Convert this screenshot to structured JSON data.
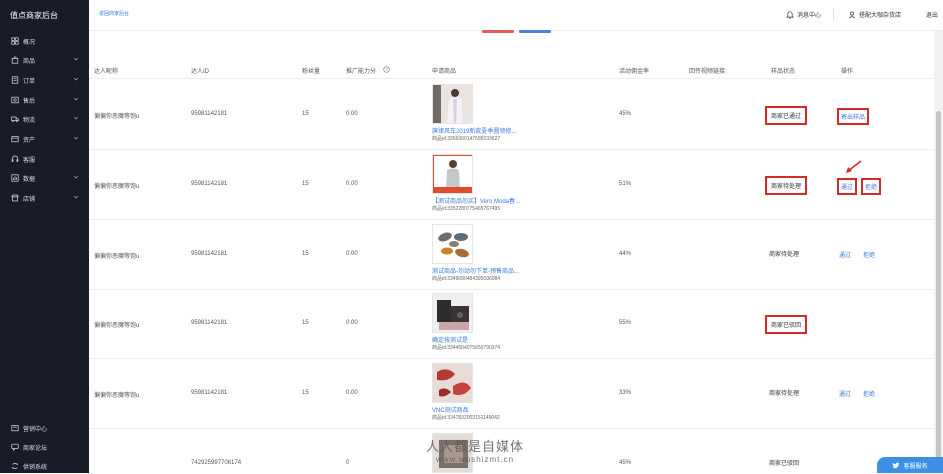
{
  "app": {
    "title": "值点商家后台"
  },
  "sidebar": {
    "items": [
      {
        "label": "概况",
        "icon": "grid-icon",
        "has_chevron": false
      },
      {
        "label": "商品",
        "icon": "bag-icon",
        "has_chevron": true
      },
      {
        "label": "订单",
        "icon": "order-icon",
        "has_chevron": true
      },
      {
        "label": "售后",
        "icon": "aftersale-icon",
        "has_chevron": true
      },
      {
        "label": "物流",
        "icon": "truck-icon",
        "has_chevron": true
      },
      {
        "label": "资产",
        "icon": "wallet-icon",
        "has_chevron": true
      },
      {
        "label": "客服",
        "icon": "headset-icon",
        "has_chevron": false
      },
      {
        "label": "数据",
        "icon": "chart-icon",
        "has_chevron": true
      },
      {
        "label": "店铺",
        "icon": "store-icon",
        "has_chevron": true
      }
    ],
    "bottom_items": [
      {
        "label": "营销中心",
        "icon": "marketing-icon"
      },
      {
        "label": "商家论坛",
        "icon": "forum-icon"
      },
      {
        "label": "供销系统",
        "icon": "supply-icon"
      }
    ]
  },
  "header": {
    "back_link": "返回商家后台",
    "message_center": "消息中心",
    "account": "搭配大咖杂货店",
    "logout": "退出"
  },
  "table": {
    "columns": [
      "达人昵称",
      "达人ID",
      "粉丝量",
      "推广能力分",
      "申请商品",
      "活动佣金率",
      "回传视频链接",
      "样品状态",
      "操作"
    ],
    "rows": [
      {
        "nickname": "偏偏你恶魔等饱u",
        "talent_id": "95981142181",
        "fans": "15",
        "score": "0.00",
        "product_name": "旗律风车2019新款夏季圆领修...",
        "product_id": "商品id:3356300147595333627",
        "commission": "45%",
        "status": "商家已通过",
        "status_boxed": true,
        "actions": [
          {
            "label": "寄出样品",
            "boxed": true
          }
        ]
      },
      {
        "nickname": "偏偏你恶魔等饱u",
        "talent_id": "95981142181",
        "fans": "15",
        "score": "0.00",
        "product_name": "【测试商品勿买】Vero Moda春...",
        "product_id": "商品id:3352280775465767495",
        "commission": "51%",
        "status": "商家待处理",
        "status_boxed": true,
        "actions": [
          {
            "label": "通过",
            "boxed": true
          },
          {
            "label": "拒绝",
            "boxed": true
          }
        ]
      },
      {
        "nickname": "偏偏你恶魔等饱u",
        "talent_id": "95981142181",
        "fans": "15",
        "score": "0.00",
        "product_name": "测试商品-勿动勿下单-预售商品...",
        "product_id": "商品id:3349090484395096084",
        "commission": "44%",
        "status": "商家待处理",
        "status_boxed": false,
        "actions": [
          {
            "label": "通过",
            "boxed": false
          },
          {
            "label": "拒绝",
            "boxed": false
          }
        ]
      },
      {
        "nickname": "偏偏你恶魔等饱u",
        "talent_id": "95981142181",
        "fans": "15",
        "score": "0.00",
        "product_name": "确定按测试是",
        "product_id": "商品id:3344504075650790374",
        "commission": "55%",
        "status": "商家已驳回",
        "status_boxed": true,
        "actions": []
      },
      {
        "nickname": "偏偏你恶魔等饱u",
        "talent_id": "95981142181",
        "fans": "15",
        "score": "0.00",
        "product_name": "VNC测试商品",
        "product_id": "商品id:3347832003151149042",
        "commission": "33%",
        "status": "商家待处理",
        "status_boxed": false,
        "actions": [
          {
            "label": "通过",
            "boxed": false
          },
          {
            "label": "拒绝",
            "boxed": false
          }
        ]
      },
      {
        "nickname": "",
        "talent_id": "742925997706174",
        "fans": "",
        "score": "0",
        "product_name": "",
        "product_id": "",
        "commission": "45%",
        "status": "商家已驳回",
        "status_boxed": false,
        "actions": []
      }
    ]
  },
  "watermark": {
    "line1": "人人都是自媒体",
    "line2": "www.woshizmt.cn"
  },
  "customer_service": "客服服务",
  "colors": {
    "sidebar_bg": "#181c29",
    "link": "#3b7ae0",
    "highlight_red": "#d42a2a",
    "cs_button": "#3b8fe5"
  }
}
